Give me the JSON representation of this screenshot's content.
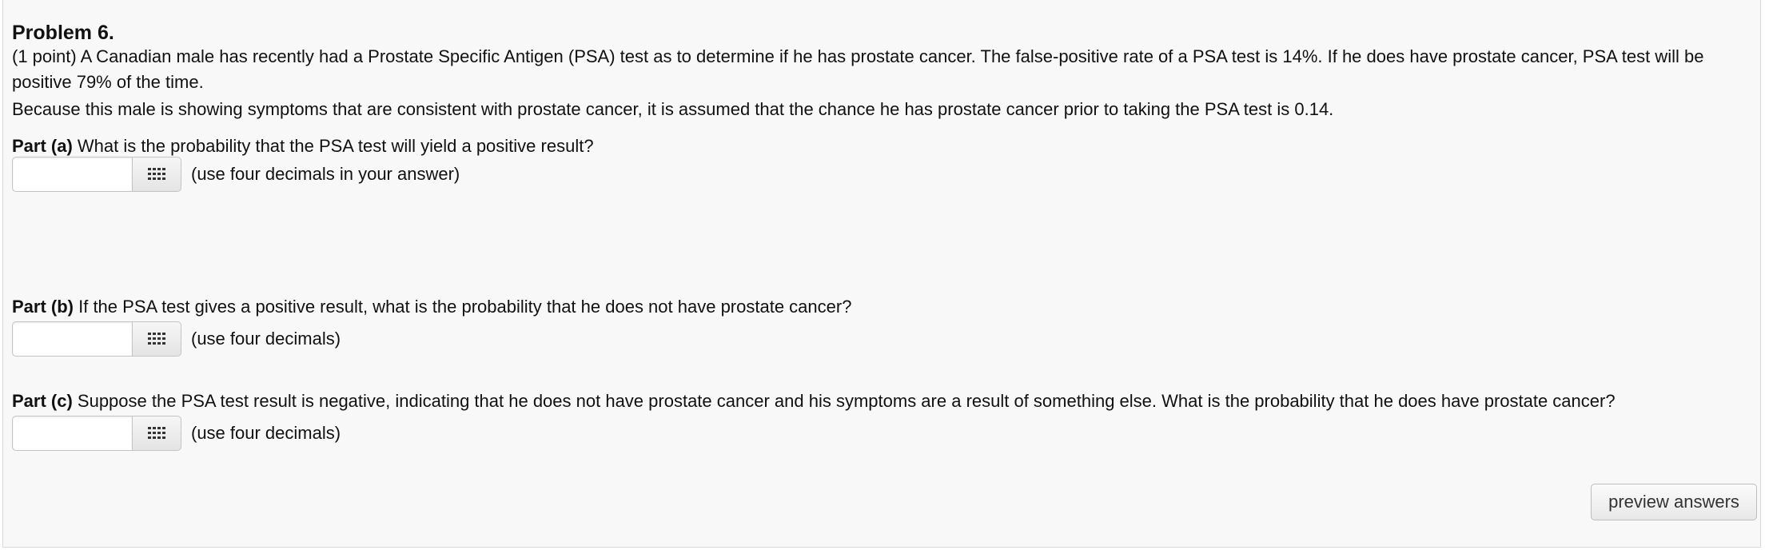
{
  "problem": {
    "title": "Problem 6.",
    "intro": "(1 point) A Canadian male has recently had a Prostate Specific Antigen (PSA) test as to determine if he has prostate cancer. The false-positive rate of a PSA test is 14%. If he does have prostate cancer, PSA test will be positive 79% of the time.",
    "context": "Because this male is showing symptoms that are consistent with prostate cancer, it is assumed that the chance he has prostate cancer prior to taking the PSA test is 0.14."
  },
  "parts": [
    {
      "label": "Part (a)",
      "question": " What is the probability that the PSA test will yield a positive result?",
      "answer_value": "",
      "hint": "(use four decimals in your answer)"
    },
    {
      "label": "Part (b)",
      "question": " If the PSA test gives a positive result, what is the probability that he does not have prostate cancer?",
      "answer_value": "",
      "hint": "(use four decimals)"
    },
    {
      "label": "Part (c)",
      "question": " Suppose the PSA test result is negative, indicating that he does not have prostate cancer and his symptoms are a result of something else. What is the probability that he does have prostate cancer?",
      "answer_value": "",
      "hint": "(use four decimals)"
    }
  ],
  "buttons": {
    "preview_label": "preview answers",
    "equation_icon": "grid-keypad-icon"
  },
  "colors": {
    "panel_background": "#f8f8f8",
    "panel_border": "#d8d8d8",
    "text": "#111111"
  }
}
